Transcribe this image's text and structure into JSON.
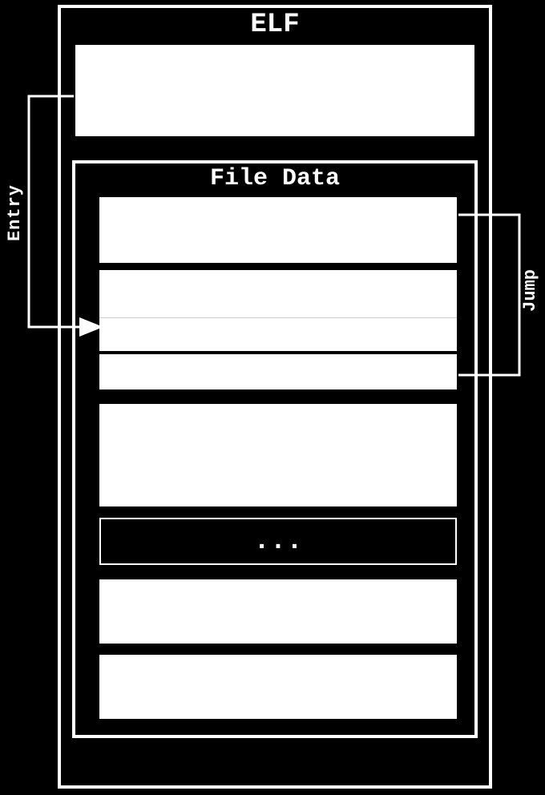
{
  "elf": {
    "title": "ELF",
    "fileData": {
      "title": "File Data",
      "ellipsis": "..."
    }
  },
  "arrows": {
    "entry": "Entry",
    "jump": "Jump"
  }
}
